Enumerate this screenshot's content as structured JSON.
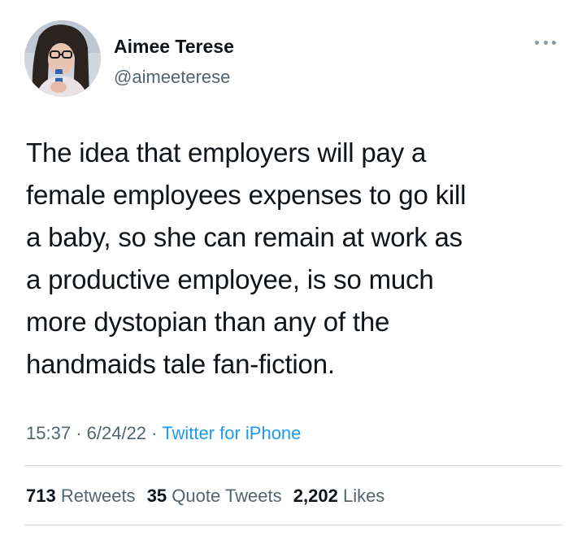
{
  "author": {
    "display_name": "Aimee Terese",
    "handle": "@aimeeterese"
  },
  "tweet": {
    "text": "The idea that employers will pay a\nfemale employees expenses to go kill\na baby, so she can remain at work as\na productive employee, is so much\nmore dystopian than any of the\nhandmaids tale fan-fiction.",
    "time": "15:37",
    "date": "6/24/22",
    "separator": "·",
    "source": "Twitter for iPhone"
  },
  "stats": {
    "retweets_count": "713",
    "retweets_label": "Retweets",
    "quotes_count": "35",
    "quotes_label": "Quote Tweets",
    "likes_count": "2,202",
    "likes_label": "Likes"
  },
  "icons": {
    "more": "more-options-icon"
  },
  "colors": {
    "text_primary": "#0f1419",
    "text_secondary": "#536471",
    "link": "#1d9bf0",
    "divider": "#cfd9de"
  }
}
